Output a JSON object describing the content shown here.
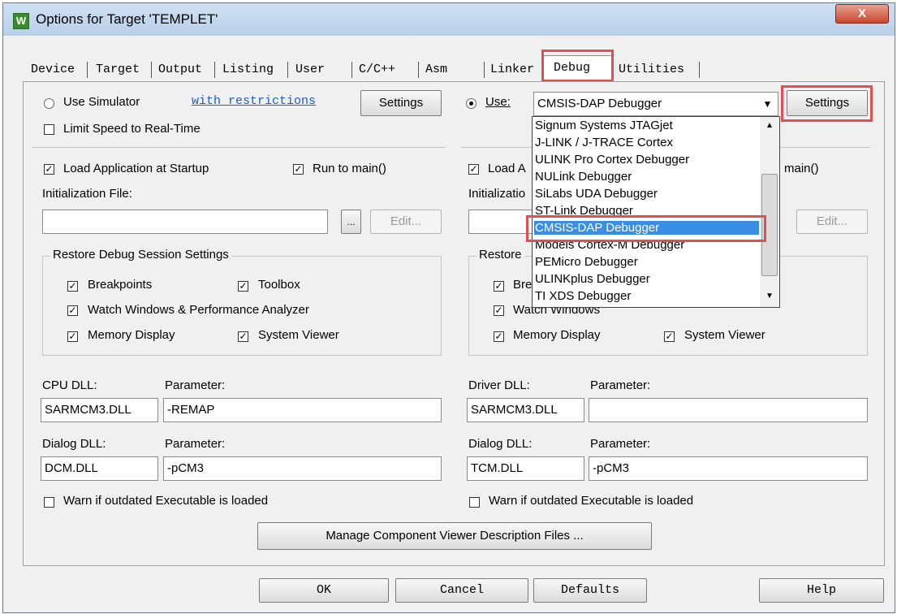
{
  "window": {
    "title": "Options for Target 'TEMPLET'",
    "close_label": "X",
    "app_icon": "W"
  },
  "tabs": [
    "Device",
    "Target",
    "Output",
    "Listing",
    "User",
    "C/C++",
    "Asm",
    "Linker",
    "Debug",
    "Utilities"
  ],
  "active_tab": "Debug",
  "left": {
    "use_simulator": "Use Simulator",
    "restrictions_link": "with restrictions",
    "settings": "Settings",
    "limit_speed": "Limit Speed to Real-Time",
    "load_app": "Load Application at Startup",
    "run_to_main": "Run to main()",
    "init_file_label": "Initialization File:",
    "browse": "...",
    "edit": "Edit...",
    "restore_title": "Restore Debug Session Settings",
    "breakpoints": "Breakpoints",
    "toolbox": "Toolbox",
    "watch_windows": "Watch Windows & Performance Analyzer",
    "memory_display": "Memory Display",
    "system_viewer": "System Viewer",
    "cpu_dll_label": "CPU DLL:",
    "cpu_param_label": "Parameter:",
    "cpu_dll": "SARMCM3.DLL",
    "cpu_param": "-REMAP",
    "dialog_dll_label": "Dialog DLL:",
    "dialog_param_label": "Parameter:",
    "dialog_dll": "DCM.DLL",
    "dialog_param": "-pCM3",
    "warn_outdated": "Warn if outdated Executable is loaded"
  },
  "right": {
    "use": "Use:",
    "debugger_selected": "CMSIS-DAP Debugger",
    "settings": "Settings",
    "load_app_partial": "Load A",
    "run_to_main_partial": "main()",
    "init_file_partial": "Initializatio",
    "edit": "Edit...",
    "restore_partial": "Restore",
    "breakpoints_partial": "Bre",
    "watch_windows": "Watch Windows",
    "memory_display": "Memory Display",
    "system_viewer": "System Viewer",
    "driver_dll_label": "Driver DLL:",
    "driver_param_label": "Parameter:",
    "driver_dll": "SARMCM3.DLL",
    "driver_param": "",
    "dialog_dll_label": "Dialog DLL:",
    "dialog_param_label": "Parameter:",
    "dialog_dll": "TCM.DLL",
    "dialog_param": "-pCM3",
    "warn_outdated": "Warn if outdated Executable is loaded"
  },
  "dropdown_items": [
    "Signum Systems JTAGjet",
    "J-LINK / J-TRACE Cortex",
    "ULINK Pro Cortex Debugger",
    "NULink Debugger",
    "SiLabs UDA Debugger",
    "ST-Link Debugger",
    "CMSIS-DAP Debugger",
    "Models Cortex-M Debugger",
    "PEMicro Debugger",
    "ULINKplus Debugger",
    "TI XDS Debugger"
  ],
  "manage_viewer": "Manage Component Viewer Description Files ...",
  "buttons": {
    "ok": "OK",
    "cancel": "Cancel",
    "defaults": "Defaults",
    "help": "Help"
  },
  "colors": {
    "highlight": "#e05050",
    "selection": "#3a8ee6",
    "link": "#1a5fd0"
  }
}
